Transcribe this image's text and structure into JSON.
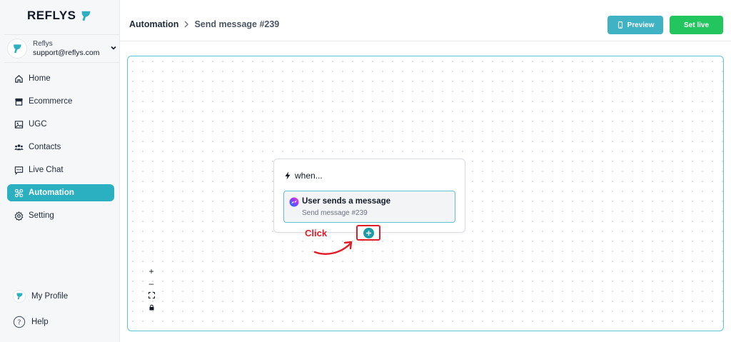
{
  "brand": {
    "name": "REFLYS",
    "accent": "#2ab0c0"
  },
  "account": {
    "name": "Reflys",
    "email": "support@reflys.com"
  },
  "nav": [
    {
      "label": "Home",
      "icon": "home-icon"
    },
    {
      "label": "Ecommerce",
      "icon": "store-icon"
    },
    {
      "label": "UGC",
      "icon": "image-icon"
    },
    {
      "label": "Contacts",
      "icon": "users-icon"
    },
    {
      "label": "Live Chat",
      "icon": "chat-icon"
    },
    {
      "label": "Automation",
      "icon": "automation-icon",
      "active": true
    },
    {
      "label": "Setting",
      "icon": "gear-icon"
    }
  ],
  "footer": {
    "profile_label": "My Profile",
    "help_label": "Help"
  },
  "header": {
    "breadcrumb_root": "Automation",
    "breadcrumb_current": "Send message #239",
    "preview_label": "Preview",
    "set_live_label": "Set live"
  },
  "trigger": {
    "heading": "when...",
    "title": "User sends a message",
    "subtitle": "Send message #239"
  },
  "annotation": {
    "click_label": "Click",
    "color": "#e11d2a"
  },
  "controls": {
    "zoom_in": "+",
    "zoom_out": "–"
  }
}
